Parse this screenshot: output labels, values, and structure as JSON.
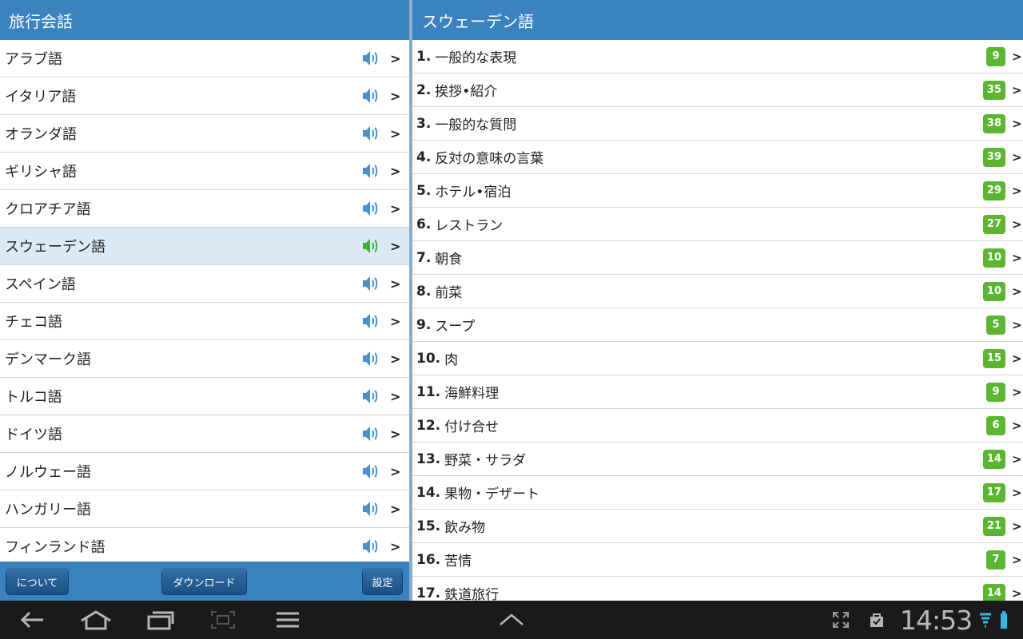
{
  "left": {
    "title": "旅行会話",
    "languages": [
      {
        "label": "アラブ語"
      },
      {
        "label": "イタリア語"
      },
      {
        "label": "オランダ語"
      },
      {
        "label": "ギリシャ語"
      },
      {
        "label": "クロアチア語"
      },
      {
        "label": "スウェーデン語",
        "selected": true
      },
      {
        "label": "スペイン語"
      },
      {
        "label": "チェコ語"
      },
      {
        "label": "デンマーク語"
      },
      {
        "label": "トルコ語"
      },
      {
        "label": "ドイツ語"
      },
      {
        "label": "ノルウェー語"
      },
      {
        "label": "ハンガリー語"
      },
      {
        "label": "フィンランド語"
      }
    ],
    "chevron": ">",
    "footer": {
      "about": "について",
      "download": "ダウンロード",
      "settings": "設定"
    }
  },
  "right": {
    "title": "スウェーデン語",
    "chevron": ">",
    "categories": [
      {
        "num": "1.",
        "label": "一般的な表現",
        "count": "9"
      },
      {
        "num": "2.",
        "label": "挨拶•紹介",
        "count": "35"
      },
      {
        "num": "3.",
        "label": "一般的な質問",
        "count": "38"
      },
      {
        "num": "4.",
        "label": "反対の意味の言葉",
        "count": "39"
      },
      {
        "num": "5.",
        "label": "ホテル•宿泊",
        "count": "29"
      },
      {
        "num": "6.",
        "label": "レストラン",
        "count": "27"
      },
      {
        "num": "7.",
        "label": "朝食",
        "count": "10"
      },
      {
        "num": "8.",
        "label": "前菜",
        "count": "10"
      },
      {
        "num": "9.",
        "label": "スープ",
        "count": "5"
      },
      {
        "num": "10.",
        "label": "肉",
        "count": "15"
      },
      {
        "num": "11.",
        "label": "海鮮料理",
        "count": "9"
      },
      {
        "num": "12.",
        "label": "付け合せ",
        "count": "6"
      },
      {
        "num": "13.",
        "label": "野菜・サラダ",
        "count": "14"
      },
      {
        "num": "14.",
        "label": "果物・デザート",
        "count": "17"
      },
      {
        "num": "15.",
        "label": "飲み物",
        "count": "21"
      },
      {
        "num": "16.",
        "label": "苦情",
        "count": "7"
      },
      {
        "num": "17.",
        "label": "鉄道旅行",
        "count": "14"
      }
    ]
  },
  "system_bar": {
    "clock": "14:53",
    "icons": [
      "back-icon",
      "home-icon",
      "recent-apps-icon",
      "screenshot-icon",
      "menu-icon",
      "chevron-up-icon",
      "fullscreen-icon",
      "shopping-bag-icon",
      "wifi-icon",
      "battery-icon"
    ]
  },
  "colors": {
    "header_blue": "#3a83c0",
    "selected_row": "#dce9f7",
    "badge_green": "#5bb531",
    "speaker_blue": "#4a8fd0",
    "speaker_green": "#3bb33b"
  }
}
